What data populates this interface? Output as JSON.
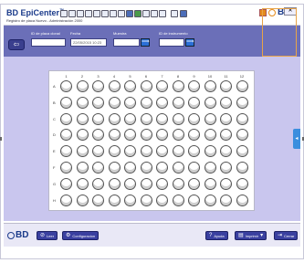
{
  "app": {
    "title": "BD EpiCenter",
    "subtitle": "Registro de placa Nuevo - Administración 2000",
    "logo": "BD"
  },
  "window": {
    "close_label": "✕"
  },
  "toolbar": {
    "icons": [
      "new-icon",
      "open-icon",
      "save-icon",
      "print-icon",
      "copy-icon",
      "paste-icon",
      "edit-icon",
      "chart-icon",
      "grid-icon",
      "tube-icon",
      "report-icon",
      "table-icon",
      "export-icon",
      "settings-icon"
    ]
  },
  "form": {
    "back_label": "⇦",
    "plate_id_label": "ID de placa clonal",
    "plate_id_value": "",
    "date_label": "Fecha",
    "date_value": "22/05/2015 10:23",
    "sample_label": "Muestra",
    "sample_value": "",
    "instrument_label": "ID de instrumento",
    "instrument_value": "",
    "go_label": "⟹"
  },
  "plate": {
    "columns": [
      "1",
      "2",
      "3",
      "4",
      "5",
      "6",
      "7",
      "8",
      "9",
      "10",
      "11",
      "12"
    ],
    "rows": [
      "A",
      "B",
      "C",
      "D",
      "E",
      "F",
      "G",
      "H"
    ]
  },
  "side_tab": {
    "label": "◂"
  },
  "bottom": {
    "logo": "BD",
    "leer_label": "Leer",
    "config_label": "Configuracion",
    "help_label": "Ayuda",
    "print_label": "Imprimir",
    "close_label": "Cerrar"
  },
  "colors": {
    "header_bar": "#6b6fb8",
    "main_bg": "#c9c6ee",
    "button": "#3a40a0",
    "accent_orange": "#e48a1b",
    "side_tab": "#3b8ede"
  }
}
